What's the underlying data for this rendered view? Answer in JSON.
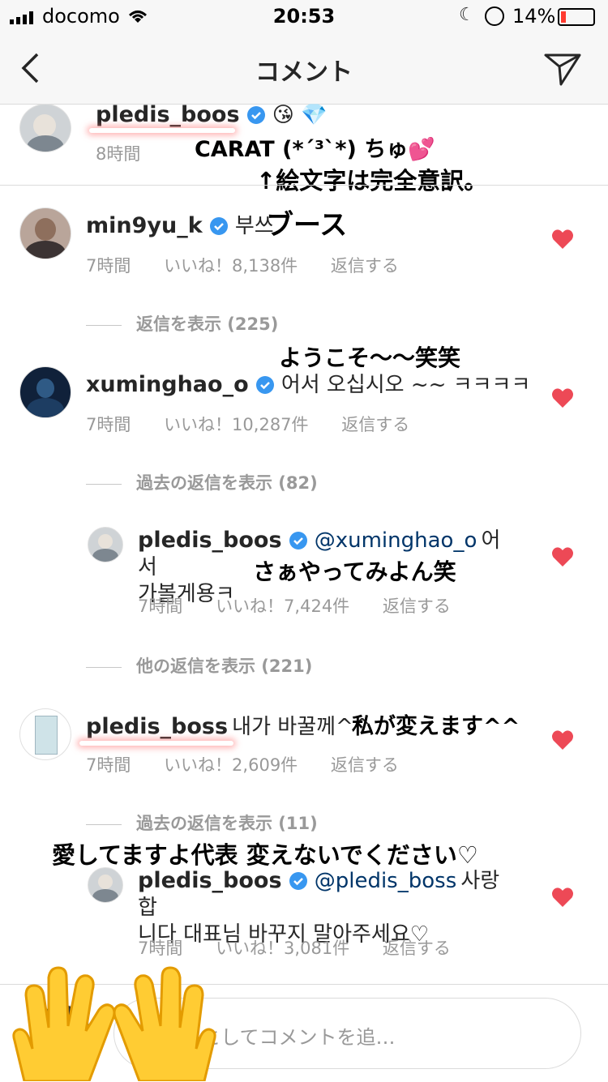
{
  "status": {
    "carrier": "docomo",
    "time": "20:53",
    "battery": "14%"
  },
  "nav": {
    "title": "コメント"
  },
  "caption": {
    "username": "pledis_boos",
    "emoji": "😘 💎",
    "time": "8時間",
    "overlay1": "CARAT (*´³`*) ちゅ💕",
    "overlay2": "↑絵文字は完全意訳。"
  },
  "comments": [
    {
      "username": "min9yu_k",
      "text": "부쓰",
      "time": "7時間",
      "likes": "いいね！8,138件",
      "reply": "返信する",
      "overlay": "ブース"
    },
    {
      "view_replies": "返信を表示 (225)"
    },
    {
      "username": "xuminghao_o",
      "text": "어서 오십시오 ~~ ㅋㅋㅋㅋ",
      "time": "7時間",
      "likes": "いいね！10,287件",
      "reply": "返信する",
      "overlay": "ようこそ〜〜笑笑"
    },
    {
      "view_replies": "過去の返信を表示 (82)"
    },
    {
      "username": "pledis_boos",
      "mention": "@xuminghao_o",
      "text_line1": "어서",
      "text_line2": "가볼게용ㅋ",
      "time": "7時間",
      "likes": "いいね！7,424件",
      "reply": "返信する",
      "overlay": "さぁやってみよん笑"
    },
    {
      "view_replies": "他の返信を表示 (221)"
    },
    {
      "username": "pledis_boss",
      "text": "내가 바꿀께^^",
      "time": "7時間",
      "likes": "いいね！2,609件",
      "reply": "返信する",
      "overlay": "私が変えます^^"
    },
    {
      "view_replies": "過去の返信を表示 (11)"
    },
    {
      "username": "pledis_boos",
      "mention": "@pledis_boss",
      "text_line1": "사랑합",
      "text_line2": "니다 대표님 바꾸지 말아주세요♡",
      "time": "7時間",
      "likes": "いいね！3,081件",
      "reply": "返信する",
      "overlay": "愛してますよ代表 変えないでください♡"
    }
  ],
  "input": {
    "placeholder": "u_としてコメントを追…"
  },
  "colors": {
    "heart": "#ed4956",
    "verified": "#3897f0",
    "mention": "#003569"
  }
}
